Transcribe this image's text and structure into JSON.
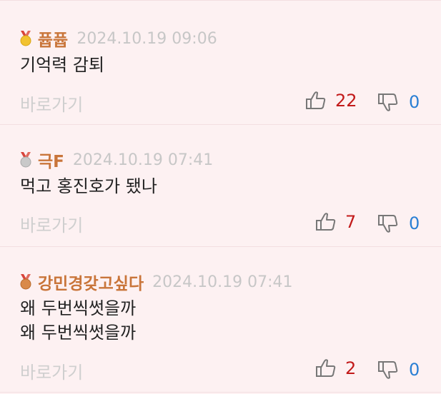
{
  "goto_label": "바로가기",
  "colors": {
    "background": "#fdf1f2",
    "nickname": "#c9753a",
    "date": "#c7c7c7",
    "like_count": "#c21a1a",
    "dislike_count": "#2a7fd4"
  },
  "comments": [
    {
      "medal": "gold-medal-icon",
      "nickname": "퓹퓹",
      "date": "2024.10.19 09:06",
      "lines": [
        "기억력 감퇴"
      ],
      "likes": "22",
      "dislikes": "0"
    },
    {
      "medal": "silver-medal-icon",
      "nickname": "극F",
      "date": "2024.10.19 07:41",
      "lines": [
        "먹고 홍진호가 됐나"
      ],
      "likes": "7",
      "dislikes": "0"
    },
    {
      "medal": "bronze-medal-icon",
      "nickname": "강민경갖고싶다",
      "date": "2024.10.19 07:41",
      "lines": [
        "왜 두번씩썻을까",
        "왜 두번씩썻을까"
      ],
      "likes": "2",
      "dislikes": "0"
    }
  ]
}
